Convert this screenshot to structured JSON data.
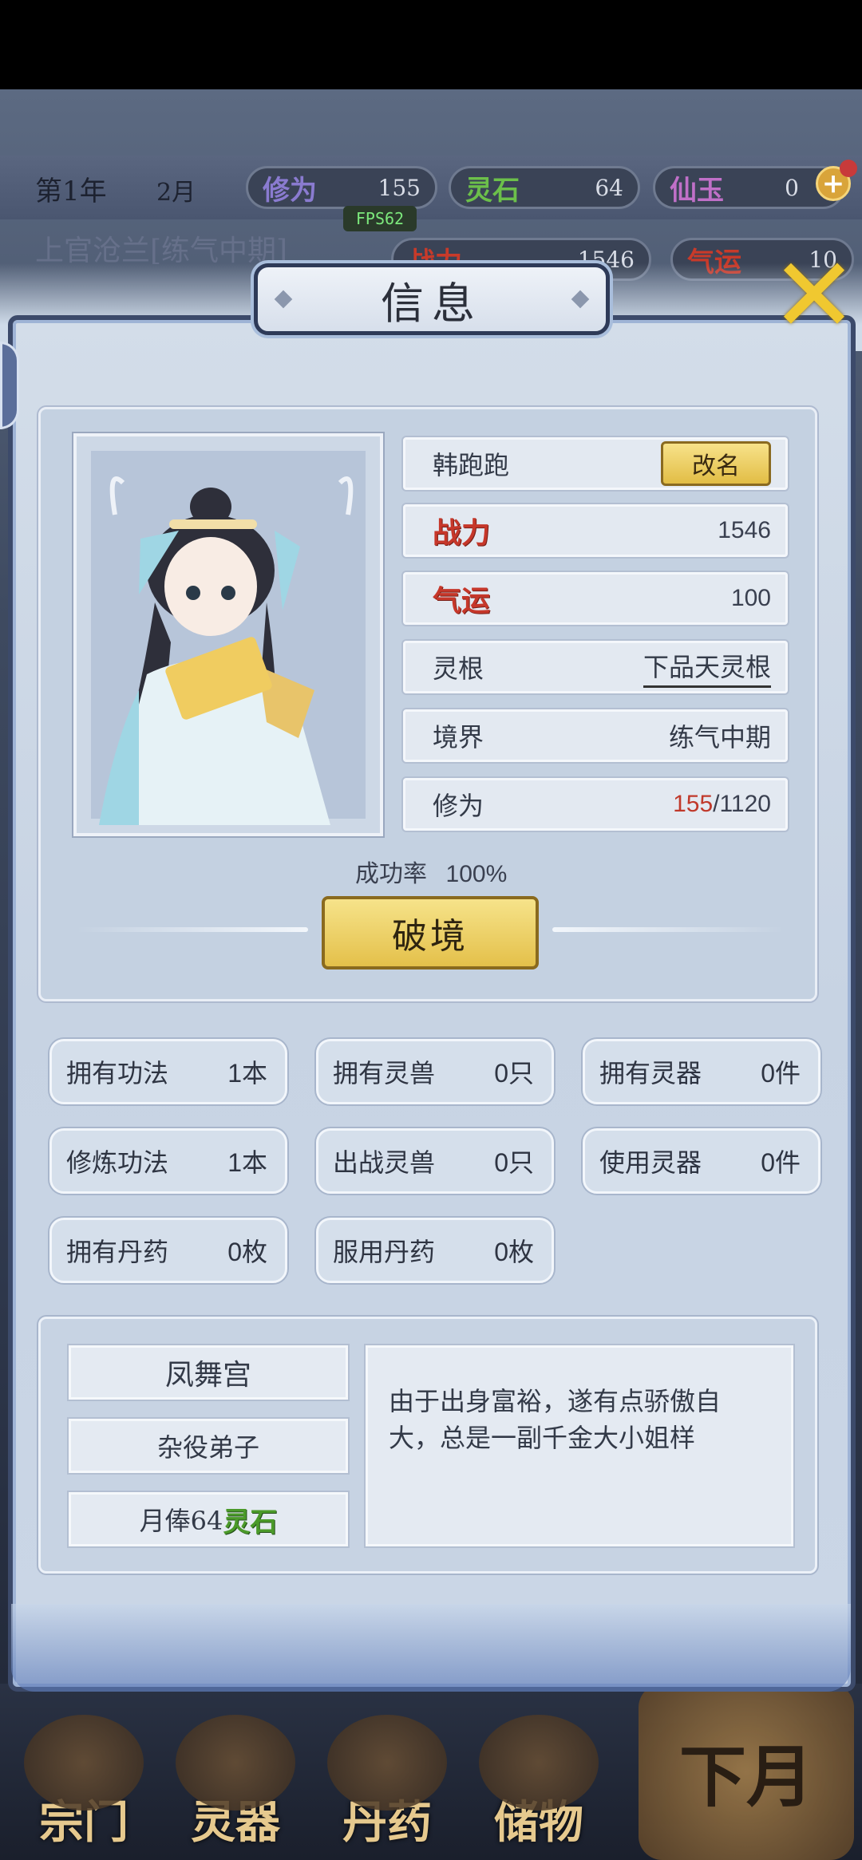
{
  "hud": {
    "year": "第1年",
    "month": "2月",
    "cultivation_label": "修为",
    "cultivation_value": "155",
    "spirit_stone_label": "灵石",
    "spirit_stone_value": "64",
    "jade_label": "仙玉",
    "jade_value": "0",
    "character_title": "上官沧兰[练气中期]",
    "power_label": "战力",
    "power_value": "1546",
    "luck_label": "气运",
    "luck_value": "10",
    "fps": "FPS62"
  },
  "dialog": {
    "title": "信息"
  },
  "character": {
    "name": "韩跑跑",
    "rename_label": "改名",
    "power_label": "战力",
    "power_value": "1546",
    "luck_label": "气运",
    "luck_value": "100",
    "root_label": "灵根",
    "root_value": "下品天灵根",
    "realm_label": "境界",
    "realm_value": "练气中期",
    "cultivation_label": "修为",
    "cultivation_current": "155",
    "cultivation_max": "/1120",
    "success_label": "成功率",
    "success_value": "100%",
    "breakthrough_label": "破境"
  },
  "stats": [
    {
      "label": "拥有功法",
      "value": "1本"
    },
    {
      "label": "拥有灵兽",
      "value": "0只"
    },
    {
      "label": "拥有灵器",
      "value": "0件"
    },
    {
      "label": "修炼功法",
      "value": "1本"
    },
    {
      "label": "出战灵兽",
      "value": "0只"
    },
    {
      "label": "使用灵器",
      "value": "0件"
    },
    {
      "label": "拥有丹药",
      "value": "0枚"
    },
    {
      "label": "服用丹药",
      "value": "0枚"
    }
  ],
  "sect": {
    "name": "凤舞宫",
    "rank": "杂役弟子",
    "salary_prefix": "月俸64",
    "salary_currency": "灵石",
    "description": "由于出身富裕，遂有点骄傲自大，总是一副千金大小姐样"
  },
  "nav": {
    "items": [
      "宗门",
      "灵器",
      "丹药",
      "储物"
    ],
    "next_month": "下月"
  },
  "icons": {
    "close": "close-x-icon",
    "plus": "plus-icon",
    "portrait": "character-portrait"
  },
  "colors": {
    "accent_gold": "#e4c04a",
    "stat_red": "#c6372a",
    "stone_green": "#4b9a2a"
  }
}
